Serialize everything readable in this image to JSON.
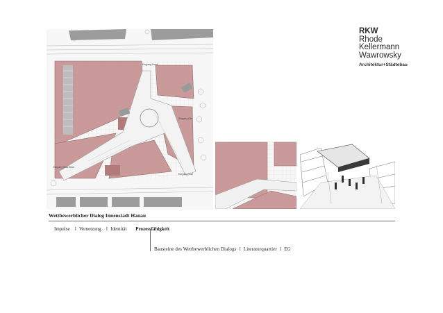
{
  "logo": {
    "lines": [
      "RKW",
      "Rhode",
      "Kellermann",
      "Wawrowsky"
    ],
    "subtitle": "Architektur+Städtebau"
  },
  "plan_labels": {
    "entrance_north": "Eingang Nord",
    "entrance_east": "Eingang Ost",
    "entrance_west_lower": "Eingang Süd-West",
    "entrance_south": "Eingang Süd"
  },
  "document": {
    "title": "Wettbewerblicher Dialog Innenstadt Hanau"
  },
  "nav": {
    "items": [
      "Impulse",
      "Vernetzung",
      "Identität",
      "Prozessfähigkeit"
    ],
    "separator": "I",
    "active_index": 3
  },
  "caption": {
    "parts": [
      "Bausteine des Wettbewerblichen Dialogs",
      "Literaturquartier",
      "EG"
    ],
    "separator": "I"
  },
  "colors": {
    "building": "#c99a99",
    "building_dark": "#b98584",
    "paving": "#f1f1f1",
    "line": "#9a9a9a",
    "rule": "#6a6a6a"
  }
}
